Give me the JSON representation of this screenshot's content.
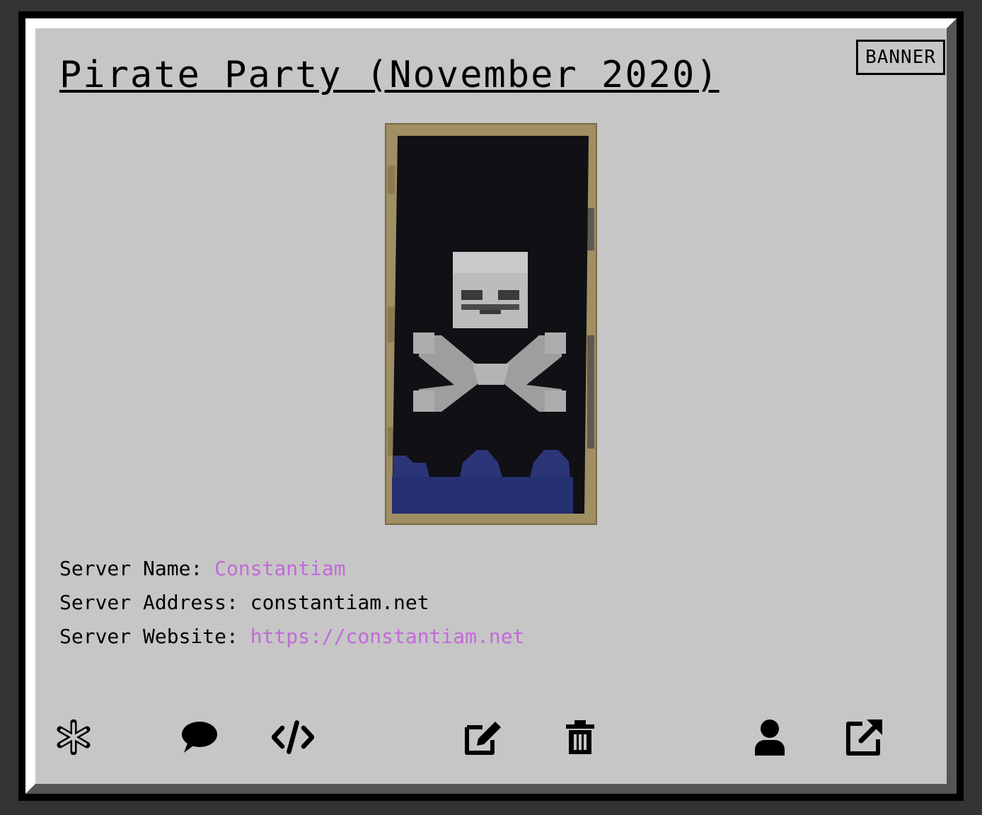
{
  "card": {
    "title": "Pirate Party (November 2020)",
    "badge": "BANNER"
  },
  "image": {
    "alt": "Pirate Party banner"
  },
  "details": {
    "server_name_label": "Server Name: ",
    "server_name_value": "Constantiam",
    "server_address_label": "Server Address: ",
    "server_address_value": "constantiam.net",
    "server_website_label": "Server Website: ",
    "server_website_value": "https://constantiam.net"
  },
  "colors": {
    "page_background": "#333333",
    "card_background": "#c6c6c6",
    "link": "#c36ad8",
    "text": "#000000"
  },
  "actions": [
    {
      "icon": "asterisk-icon"
    },
    {
      "icon": "comment-icon"
    },
    {
      "icon": "code-icon"
    },
    {
      "icon": "edit-icon"
    },
    {
      "icon": "trash-icon"
    },
    {
      "icon": "user-icon"
    },
    {
      "icon": "external-link-icon"
    }
  ]
}
